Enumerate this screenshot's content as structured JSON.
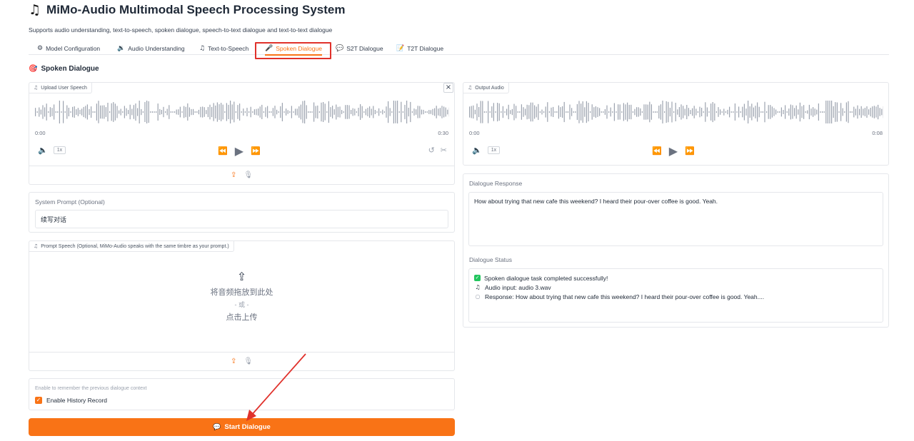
{
  "app": {
    "title": "MiMo-Audio Multimodal Speech Processing System",
    "title_icon": "music-note-icon",
    "subtitle": "Supports audio understanding, text-to-speech, spoken dialogue, speech-to-text dialogue and text-to-text dialogue"
  },
  "tabs": [
    {
      "label": "Model Configuration",
      "icon": "⚙"
    },
    {
      "label": "Audio Understanding",
      "icon": "🔉"
    },
    {
      "label": "Text-to-Speech",
      "icon": "♫"
    },
    {
      "label": "Spoken Dialogue",
      "icon": "🎤",
      "active": true
    },
    {
      "label": "S2T Dialogue",
      "icon": "💬"
    },
    {
      "label": "T2T Dialogue",
      "icon": "📝"
    }
  ],
  "section": {
    "title": "Spoken Dialogue",
    "icon": "🎯"
  },
  "upload_audio": {
    "label": "Upload User Speech",
    "start_time": "0:00",
    "end_time": "0:30",
    "speed": "1x"
  },
  "system_prompt": {
    "label": "System Prompt (Optional)",
    "value": "续写对话"
  },
  "prompt_speech": {
    "label": "Prompt Speech (Optional, MiMo-Audio speaks with the same timbre as your prompt.)",
    "drop_text": "将音频拖放到此处",
    "or_text": "- 或 -",
    "click_text": "点击上传"
  },
  "history": {
    "hint": "Enable to remember the previous dialogue context",
    "label": "Enable History Record",
    "checked": true
  },
  "start_button": {
    "label": "Start Dialogue"
  },
  "output_audio": {
    "label": "Output Audio",
    "start_time": "0:00",
    "end_time": "0:08",
    "speed": "1x"
  },
  "dialogue_response": {
    "label": "Dialogue Response",
    "text": "How about trying that new cafe this weekend? I heard their pour-over coffee is good. Yeah."
  },
  "dialogue_status": {
    "label": "Dialogue Status",
    "lines": [
      "Spoken dialogue task completed successfully!",
      "Audio input: audio 3.wav",
      "Response: How about trying that new cafe this weekend? I heard their pour-over coffee is good. Yeah...."
    ]
  },
  "colors": {
    "accent": "#f97316",
    "highlight": "#e0312b",
    "success": "#22c55e"
  }
}
